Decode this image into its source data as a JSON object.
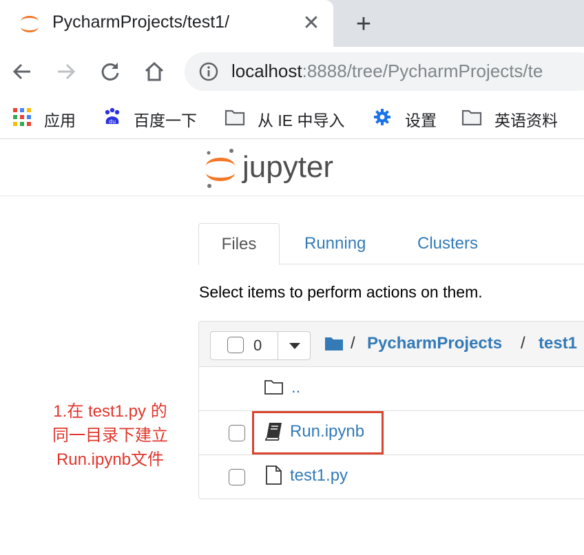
{
  "browser": {
    "tab": {
      "title": "PycharmProjects/test1/",
      "close_glyph": "✕"
    },
    "new_tab_glyph": "+",
    "address": {
      "host": "localhost",
      "rest": ":8888/tree/PycharmProjects/te"
    },
    "bookmarks": [
      {
        "label": "应用",
        "icon": "apps-grid-icon"
      },
      {
        "label": "百度一下",
        "icon": "baidu-paw-icon"
      },
      {
        "label": "从 IE 中导入",
        "icon": "folder-icon"
      },
      {
        "label": "设置",
        "icon": "gear-icon"
      },
      {
        "label": "英语资料",
        "icon": "folder-icon"
      }
    ]
  },
  "jupyter": {
    "logo_text": "jupyter",
    "tabs": [
      {
        "label": "Files",
        "active": true
      },
      {
        "label": "Running",
        "active": false
      },
      {
        "label": "Clusters",
        "active": false
      }
    ],
    "hint": "Select items to perform actions on them.",
    "selected_count": "0",
    "breadcrumb": {
      "sep": "/",
      "items": [
        "PycharmProjects",
        "test1"
      ]
    },
    "rows": [
      {
        "name": "..",
        "icon": "folder-outline-icon",
        "checkbox": false
      },
      {
        "name": "Run.ipynb",
        "icon": "notebook-icon",
        "checkbox": true
      },
      {
        "name": "test1.py",
        "icon": "file-icon",
        "checkbox": true
      }
    ]
  },
  "annotation": {
    "lines": [
      "1.在 test1.py 的",
      "同一目录下建立",
      "Run.ipynb文件"
    ],
    "color": "#e0352b"
  },
  "colors": {
    "link": "#337ab7",
    "jupyter_orange": "#f37726"
  }
}
